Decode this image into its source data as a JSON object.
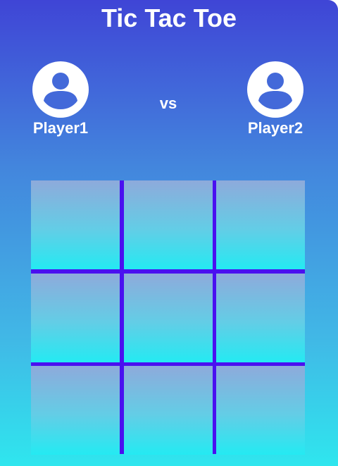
{
  "title": "Tic Tac Toe",
  "players": [
    {
      "name": "Player1",
      "avatar_icon": "user-avatar-icon"
    },
    {
      "name": "Player2",
      "avatar_icon": "user-avatar-icon"
    }
  ],
  "versus_label": "vs",
  "board": {
    "cells": [
      "",
      "",
      "",
      "",
      "",
      "",
      "",
      "",
      ""
    ]
  },
  "colors": {
    "background_top": "#3f45d6",
    "background_bottom": "#2fe6ee",
    "grid_lines": "#4a10f0",
    "cell_top": "#8eaadb",
    "cell_bottom": "#24eaf2",
    "text": "#ffffff"
  }
}
